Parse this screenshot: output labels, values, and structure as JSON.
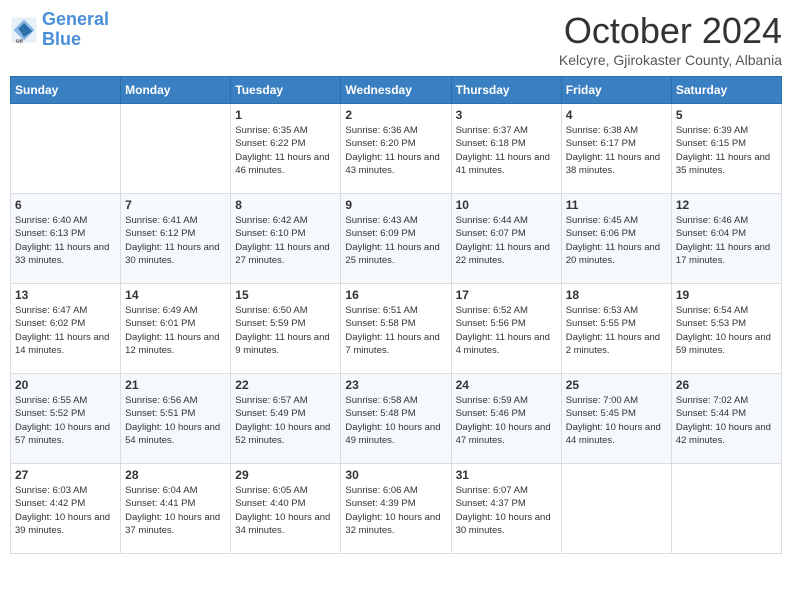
{
  "header": {
    "logo_line1": "General",
    "logo_line2": "Blue",
    "month": "October 2024",
    "location": "Kelcyre, Gjirokaster County, Albania"
  },
  "weekdays": [
    "Sunday",
    "Monday",
    "Tuesday",
    "Wednesday",
    "Thursday",
    "Friday",
    "Saturday"
  ],
  "weeks": [
    [
      {
        "day": "",
        "sunrise": "",
        "sunset": "",
        "daylight": ""
      },
      {
        "day": "",
        "sunrise": "",
        "sunset": "",
        "daylight": ""
      },
      {
        "day": "1",
        "sunrise": "Sunrise: 6:35 AM",
        "sunset": "Sunset: 6:22 PM",
        "daylight": "Daylight: 11 hours and 46 minutes."
      },
      {
        "day": "2",
        "sunrise": "Sunrise: 6:36 AM",
        "sunset": "Sunset: 6:20 PM",
        "daylight": "Daylight: 11 hours and 43 minutes."
      },
      {
        "day": "3",
        "sunrise": "Sunrise: 6:37 AM",
        "sunset": "Sunset: 6:18 PM",
        "daylight": "Daylight: 11 hours and 41 minutes."
      },
      {
        "day": "4",
        "sunrise": "Sunrise: 6:38 AM",
        "sunset": "Sunset: 6:17 PM",
        "daylight": "Daylight: 11 hours and 38 minutes."
      },
      {
        "day": "5",
        "sunrise": "Sunrise: 6:39 AM",
        "sunset": "Sunset: 6:15 PM",
        "daylight": "Daylight: 11 hours and 35 minutes."
      }
    ],
    [
      {
        "day": "6",
        "sunrise": "Sunrise: 6:40 AM",
        "sunset": "Sunset: 6:13 PM",
        "daylight": "Daylight: 11 hours and 33 minutes."
      },
      {
        "day": "7",
        "sunrise": "Sunrise: 6:41 AM",
        "sunset": "Sunset: 6:12 PM",
        "daylight": "Daylight: 11 hours and 30 minutes."
      },
      {
        "day": "8",
        "sunrise": "Sunrise: 6:42 AM",
        "sunset": "Sunset: 6:10 PM",
        "daylight": "Daylight: 11 hours and 27 minutes."
      },
      {
        "day": "9",
        "sunrise": "Sunrise: 6:43 AM",
        "sunset": "Sunset: 6:09 PM",
        "daylight": "Daylight: 11 hours and 25 minutes."
      },
      {
        "day": "10",
        "sunrise": "Sunrise: 6:44 AM",
        "sunset": "Sunset: 6:07 PM",
        "daylight": "Daylight: 11 hours and 22 minutes."
      },
      {
        "day": "11",
        "sunrise": "Sunrise: 6:45 AM",
        "sunset": "Sunset: 6:06 PM",
        "daylight": "Daylight: 11 hours and 20 minutes."
      },
      {
        "day": "12",
        "sunrise": "Sunrise: 6:46 AM",
        "sunset": "Sunset: 6:04 PM",
        "daylight": "Daylight: 11 hours and 17 minutes."
      }
    ],
    [
      {
        "day": "13",
        "sunrise": "Sunrise: 6:47 AM",
        "sunset": "Sunset: 6:02 PM",
        "daylight": "Daylight: 11 hours and 14 minutes."
      },
      {
        "day": "14",
        "sunrise": "Sunrise: 6:49 AM",
        "sunset": "Sunset: 6:01 PM",
        "daylight": "Daylight: 11 hours and 12 minutes."
      },
      {
        "day": "15",
        "sunrise": "Sunrise: 6:50 AM",
        "sunset": "Sunset: 5:59 PM",
        "daylight": "Daylight: 11 hours and 9 minutes."
      },
      {
        "day": "16",
        "sunrise": "Sunrise: 6:51 AM",
        "sunset": "Sunset: 5:58 PM",
        "daylight": "Daylight: 11 hours and 7 minutes."
      },
      {
        "day": "17",
        "sunrise": "Sunrise: 6:52 AM",
        "sunset": "Sunset: 5:56 PM",
        "daylight": "Daylight: 11 hours and 4 minutes."
      },
      {
        "day": "18",
        "sunrise": "Sunrise: 6:53 AM",
        "sunset": "Sunset: 5:55 PM",
        "daylight": "Daylight: 11 hours and 2 minutes."
      },
      {
        "day": "19",
        "sunrise": "Sunrise: 6:54 AM",
        "sunset": "Sunset: 5:53 PM",
        "daylight": "Daylight: 10 hours and 59 minutes."
      }
    ],
    [
      {
        "day": "20",
        "sunrise": "Sunrise: 6:55 AM",
        "sunset": "Sunset: 5:52 PM",
        "daylight": "Daylight: 10 hours and 57 minutes."
      },
      {
        "day": "21",
        "sunrise": "Sunrise: 6:56 AM",
        "sunset": "Sunset: 5:51 PM",
        "daylight": "Daylight: 10 hours and 54 minutes."
      },
      {
        "day": "22",
        "sunrise": "Sunrise: 6:57 AM",
        "sunset": "Sunset: 5:49 PM",
        "daylight": "Daylight: 10 hours and 52 minutes."
      },
      {
        "day": "23",
        "sunrise": "Sunrise: 6:58 AM",
        "sunset": "Sunset: 5:48 PM",
        "daylight": "Daylight: 10 hours and 49 minutes."
      },
      {
        "day": "24",
        "sunrise": "Sunrise: 6:59 AM",
        "sunset": "Sunset: 5:46 PM",
        "daylight": "Daylight: 10 hours and 47 minutes."
      },
      {
        "day": "25",
        "sunrise": "Sunrise: 7:00 AM",
        "sunset": "Sunset: 5:45 PM",
        "daylight": "Daylight: 10 hours and 44 minutes."
      },
      {
        "day": "26",
        "sunrise": "Sunrise: 7:02 AM",
        "sunset": "Sunset: 5:44 PM",
        "daylight": "Daylight: 10 hours and 42 minutes."
      }
    ],
    [
      {
        "day": "27",
        "sunrise": "Sunrise: 6:03 AM",
        "sunset": "Sunset: 4:42 PM",
        "daylight": "Daylight: 10 hours and 39 minutes."
      },
      {
        "day": "28",
        "sunrise": "Sunrise: 6:04 AM",
        "sunset": "Sunset: 4:41 PM",
        "daylight": "Daylight: 10 hours and 37 minutes."
      },
      {
        "day": "29",
        "sunrise": "Sunrise: 6:05 AM",
        "sunset": "Sunset: 4:40 PM",
        "daylight": "Daylight: 10 hours and 34 minutes."
      },
      {
        "day": "30",
        "sunrise": "Sunrise: 6:06 AM",
        "sunset": "Sunset: 4:39 PM",
        "daylight": "Daylight: 10 hours and 32 minutes."
      },
      {
        "day": "31",
        "sunrise": "Sunrise: 6:07 AM",
        "sunset": "Sunset: 4:37 PM",
        "daylight": "Daylight: 10 hours and 30 minutes."
      },
      {
        "day": "",
        "sunrise": "",
        "sunset": "",
        "daylight": ""
      },
      {
        "day": "",
        "sunrise": "",
        "sunset": "",
        "daylight": ""
      }
    ]
  ]
}
